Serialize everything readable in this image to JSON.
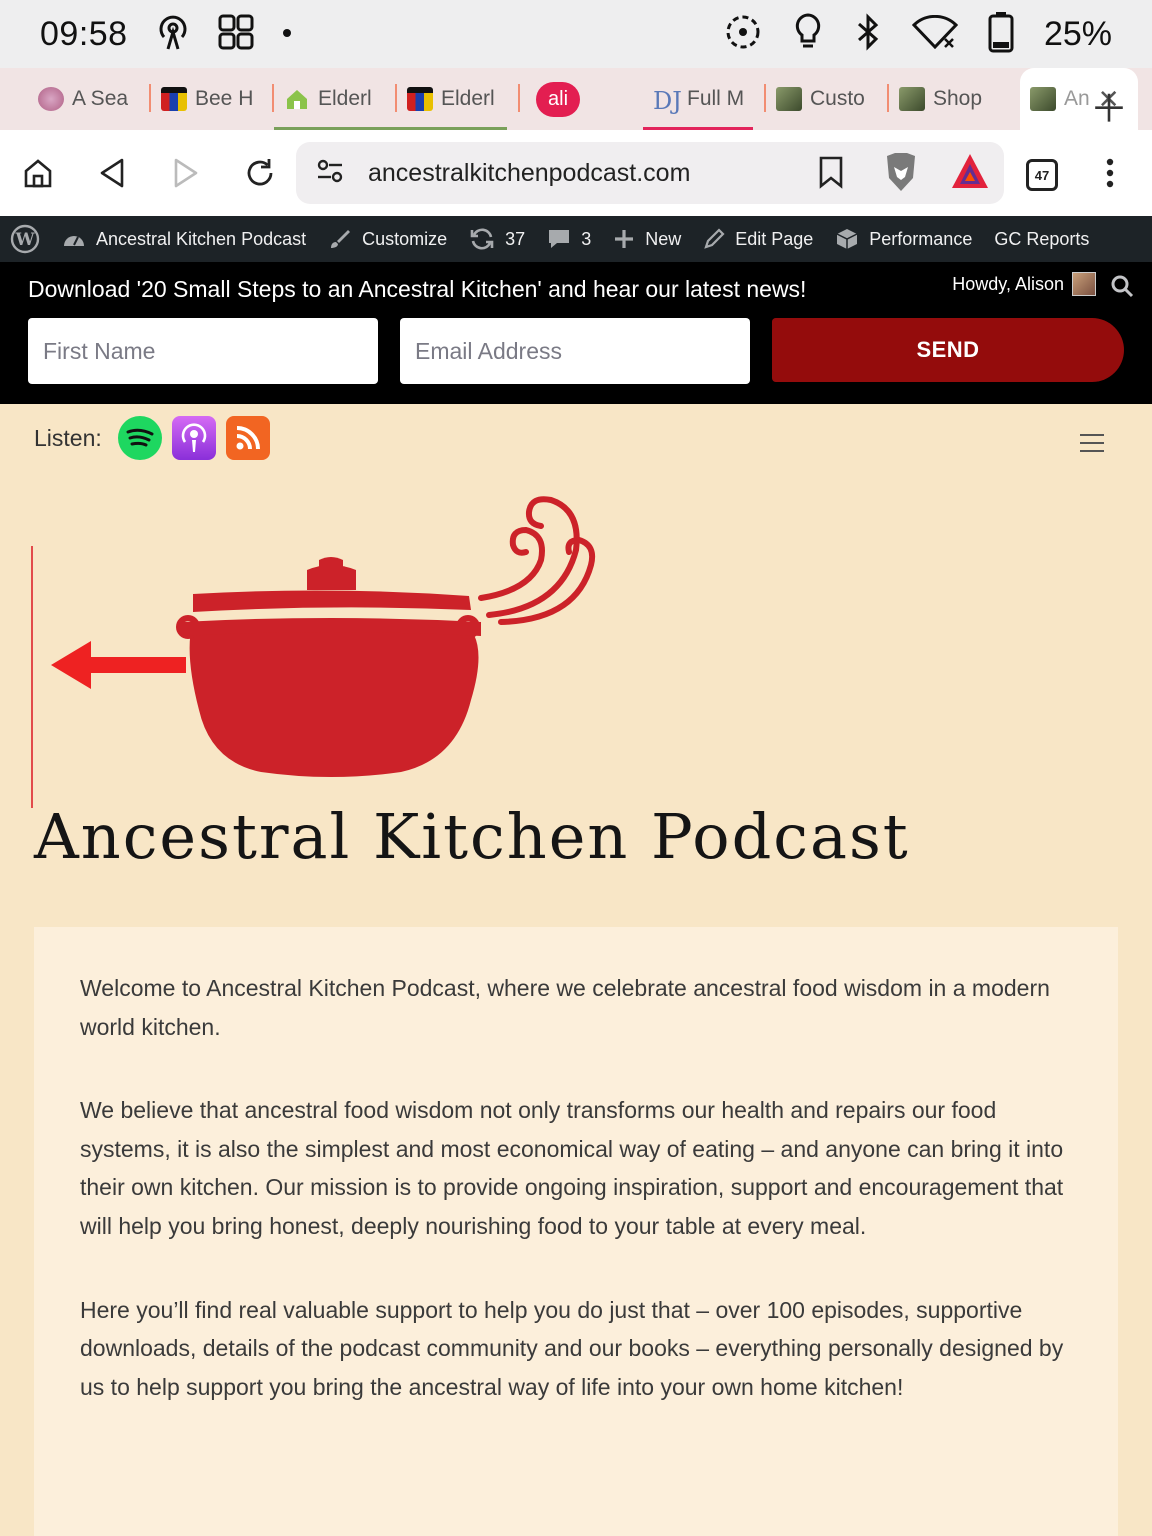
{
  "status_bar": {
    "time": "09:58",
    "battery": "25%",
    "icons": [
      "podcast-icon",
      "grid-app-icon",
      "dot-icon",
      "sync-icon",
      "bulb-icon",
      "bluetooth-icon",
      "wifi-off-icon",
      "battery-icon"
    ]
  },
  "tabs": [
    {
      "label": "A Sea",
      "icon": "purple-flower-favicon"
    },
    {
      "label": "Bee H",
      "icon": "bag-favicon"
    },
    {
      "label": "Elderl",
      "icon": "house-favicon"
    },
    {
      "label": "Elderl",
      "icon": "bag-favicon"
    },
    {
      "label": "ali",
      "icon": "ali-badge"
    },
    {
      "label": "Full M",
      "icon": "dj-favicon"
    },
    {
      "label": "Custo",
      "icon": "photo-favicon"
    },
    {
      "label": "Shop",
      "icon": "photo-favicon"
    },
    {
      "label": "An",
      "icon": "photo-favicon",
      "active": true
    }
  ],
  "toolbar": {
    "url": "ancestralkitchenpodcast.com",
    "tab_count": "47"
  },
  "admin_bar": {
    "site_name": "Ancestral Kitchen Podcast",
    "customize": "Customize",
    "updates": "37",
    "comments": "3",
    "new": "New",
    "edit_page": "Edit Page",
    "performance": "Performance",
    "gc_reports": "GC Reports"
  },
  "newsletter": {
    "message": "Download '20 Small Steps to an Ancestral Kitchen' and hear our latest news!",
    "howdy": "Howdy, Alison",
    "first_name_placeholder": "First Name",
    "email_placeholder": "Email Address",
    "send_label": "SEND"
  },
  "header": {
    "listen_label": "Listen:",
    "site_title": "Ancestral Kitchen Podcast"
  },
  "content": {
    "paragraphs": [
      "Welcome to Ancestral Kitchen Podcast, where we celebrate ancestral food wisdom in a modern world kitchen.",
      "We believe that ancestral food wisdom not only transforms our health and repairs our food systems, it is also the simplest and most economical way of eating – and anyone can bring it into their own kitchen. Our mission is to provide ongoing inspiration, support and encouragement that will help you bring honest, deeply nourishing food to your table at every meal.",
      "Here you’ll find real valuable support to help you do just that – over 100 episodes, supportive downloads, details of the podcast community and our books – everything personally designed by us to help support you bring the ancestral way of life into your own home kitchen!"
    ]
  },
  "colors": {
    "send_button": "#940c0c",
    "page_bg": "#f8e6c6",
    "card_bg": "#fcefdb",
    "pot_red": "#cc2229"
  }
}
